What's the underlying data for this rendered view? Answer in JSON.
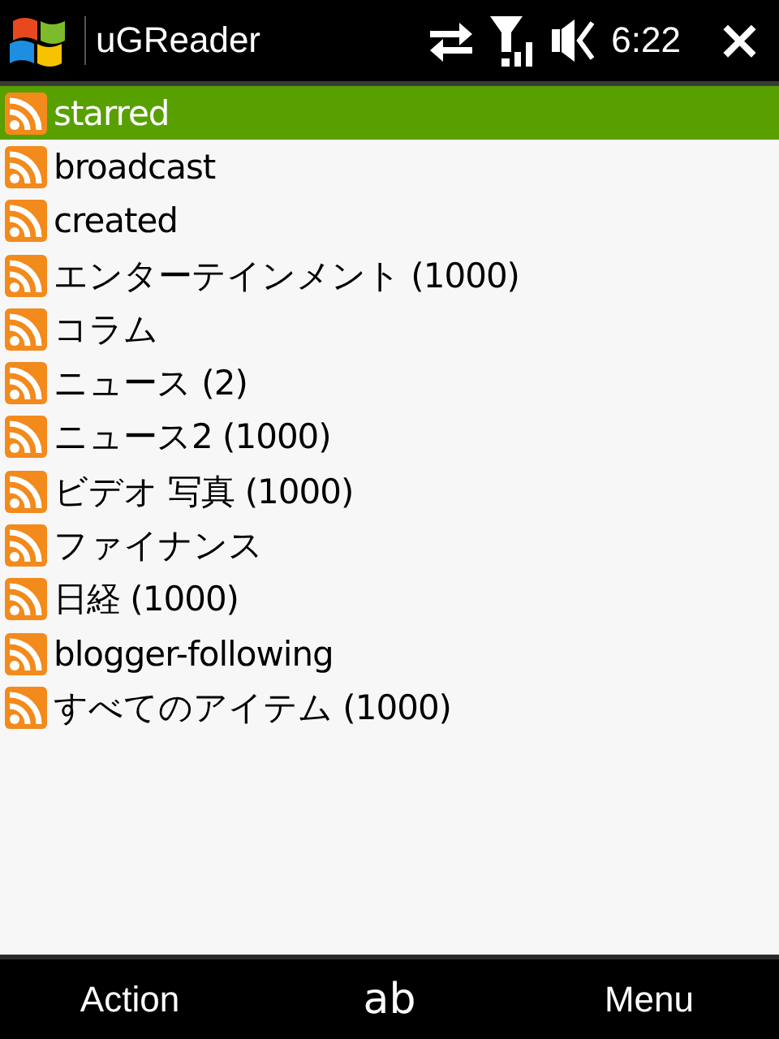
{
  "title_bar": {
    "title": "uGReader",
    "time": "6:22",
    "close": "×"
  },
  "feeds": [
    {
      "label": "starred",
      "selected": true
    },
    {
      "label": "broadcast",
      "selected": false
    },
    {
      "label": "created",
      "selected": false
    },
    {
      "label": "エンターテインメント (1000)",
      "selected": false
    },
    {
      "label": "コラム",
      "selected": false
    },
    {
      "label": "ニュース (2)",
      "selected": false
    },
    {
      "label": "ニュース2 (1000)",
      "selected": false
    },
    {
      "label": "ビデオ 写真 (1000)",
      "selected": false
    },
    {
      "label": "ファイナンス",
      "selected": false
    },
    {
      "label": "日経 (1000)",
      "selected": false
    },
    {
      "label": "blogger-following",
      "selected": false
    },
    {
      "label": "すべてのアイテム (1000)",
      "selected": false
    }
  ],
  "soft_keys": {
    "left": "Action",
    "input_mode": "ab",
    "right": "Menu"
  }
}
